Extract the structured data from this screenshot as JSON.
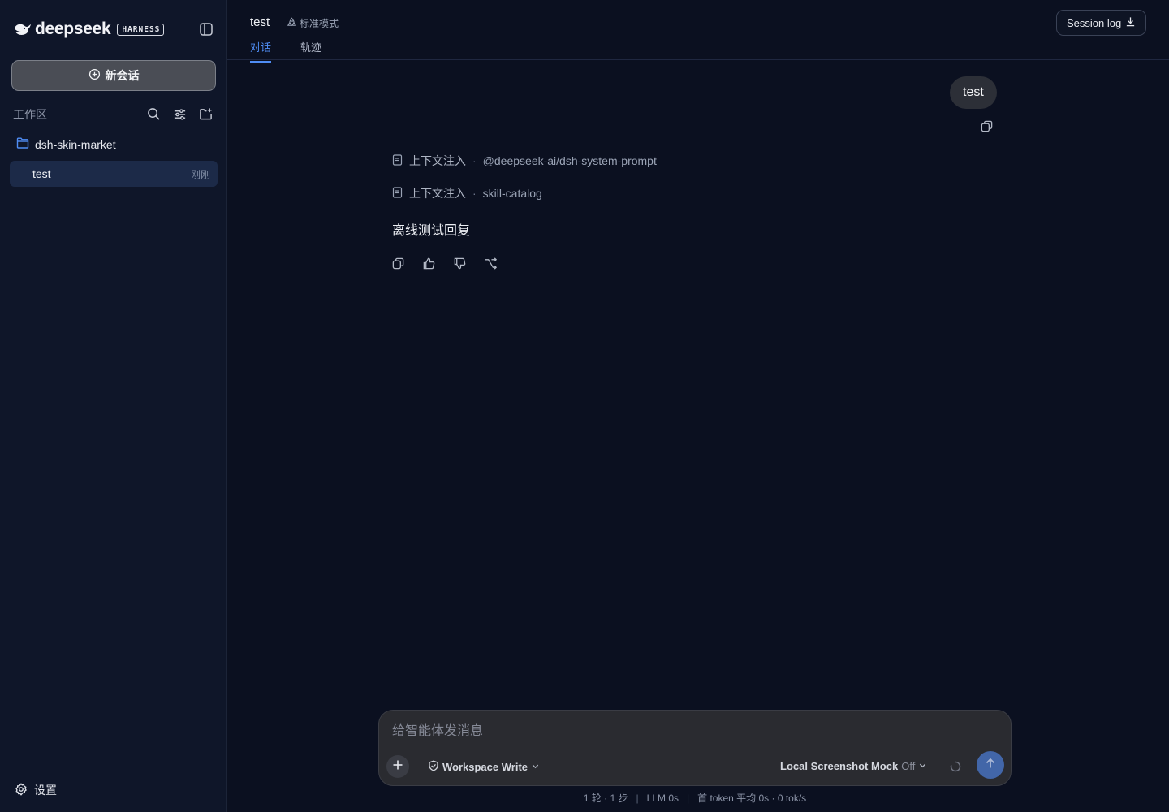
{
  "sidebar": {
    "brand_name": "deepseek",
    "brand_badge": "HARNESS",
    "new_chat_label": "新会话",
    "workspace_label": "工作区",
    "folder_name": "dsh-skin-market",
    "sessions": [
      {
        "title": "test",
        "time": "刚刚"
      }
    ],
    "settings_label": "设置"
  },
  "header": {
    "title": "test",
    "mode": "标准模式",
    "tabs": [
      {
        "label": "对话",
        "active": true
      },
      {
        "label": "轨迹",
        "active": false
      }
    ],
    "session_log_label": "Session log"
  },
  "messages": {
    "user_text": "test",
    "context_injections": [
      {
        "label": "上下文注入",
        "source": "@deepseek-ai/dsh-system-prompt"
      },
      {
        "label": "上下文注入",
        "source": "skill-catalog"
      }
    ],
    "assistant_text": "离线测试回复"
  },
  "composer": {
    "placeholder": "给智能体发消息",
    "permission_label": "Workspace Write",
    "mock_name": "Local Screenshot Mock",
    "mock_state": "Off"
  },
  "stats": {
    "rounds": "1 轮 · 1 步",
    "llm": "LLM 0s",
    "token": "首 token 平均 0s · 0 tok/s"
  },
  "colors": {
    "accent": "#4f8df5",
    "background": "#0b1020",
    "sidebar": "#0f1629",
    "selected_row": "#1c2a48",
    "send_button": "#4266a8"
  }
}
